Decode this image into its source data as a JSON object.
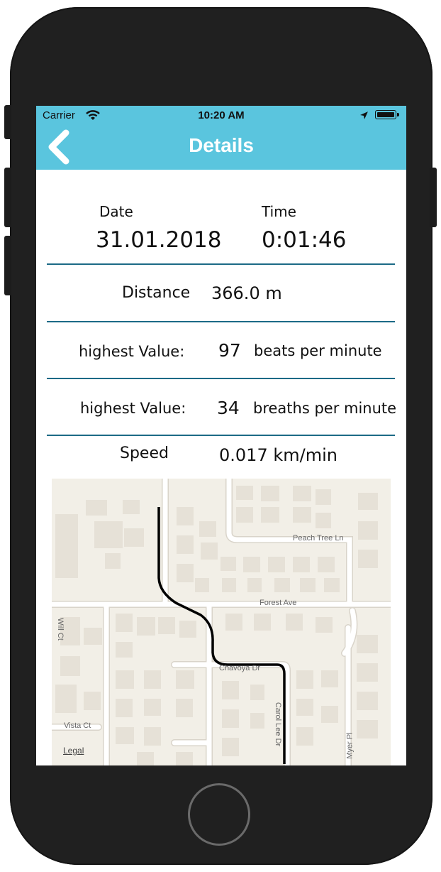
{
  "status_bar": {
    "carrier": "Carrier",
    "time": "10:20 AM"
  },
  "nav": {
    "title": "Details"
  },
  "date": {
    "label": "Date",
    "value": "31.01.2018"
  },
  "time": {
    "label": "Time",
    "value": "0:01:46"
  },
  "distance": {
    "label": "Distance",
    "value": "366.0 m"
  },
  "heart": {
    "label": "highest Value:",
    "value": "97",
    "unit": "beats per minute"
  },
  "breath": {
    "label": "highest Value:",
    "value": "34",
    "unit": "breaths per minute"
  },
  "speed": {
    "label": "Speed",
    "value": "0.017 km/min"
  },
  "map": {
    "streets": [
      "Peach Tree Ln",
      "Forest Ave",
      "Chavoya Dr",
      "Carol Lee Dr",
      "Will Ct",
      "Vista Ct",
      "Myer Pl"
    ],
    "legal": "Legal",
    "route_color": "#000000"
  },
  "colors": {
    "accent": "#5ac5de",
    "separator": "#1c6a86"
  }
}
